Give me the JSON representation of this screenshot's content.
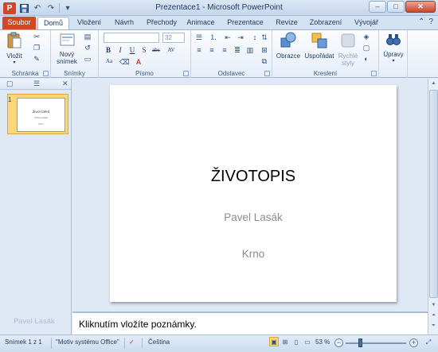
{
  "window": {
    "title": "Prezentace1 - Microsoft PowerPoint",
    "minimize_icon": "minimize-icon",
    "maximize_icon": "maximize-icon",
    "close_icon": "close-icon"
  },
  "qat": {
    "logo_text": "P",
    "save_icon": "save-icon",
    "undo_icon": "undo-icon",
    "redo_icon": "redo-icon"
  },
  "tabs": [
    {
      "label": "Soubor"
    },
    {
      "label": "Domů"
    },
    {
      "label": "Vložení"
    },
    {
      "label": "Návrh"
    },
    {
      "label": "Přechody"
    },
    {
      "label": "Animace"
    },
    {
      "label": "Prezentace"
    },
    {
      "label": "Revize"
    },
    {
      "label": "Zobrazení"
    },
    {
      "label": "Vývojář"
    }
  ],
  "ribbon": {
    "clipboard": {
      "paste_label": "Vložit",
      "group_label": "Schránka"
    },
    "slides": {
      "new_slide_label_1": "Nový",
      "new_slide_label_2": "snímek",
      "group_label": "Snímky"
    },
    "font": {
      "size_value": "32",
      "group_label": "Písmo",
      "bold": "B",
      "italic": "I",
      "underline": "U",
      "strike": "S",
      "shadow": "abc",
      "spacing": "AV",
      "case": "Aa"
    },
    "paragraph": {
      "group_label": "Odstavec"
    },
    "drawing": {
      "shapes_label": "Obrazce",
      "arrange_label": "Uspořádat",
      "quick_styles_label_1": "Rychlé",
      "quick_styles_label_2": "styly",
      "group_label": "Kreslení"
    },
    "editing": {
      "label": "Úpravy"
    }
  },
  "left_pane": {
    "slide_number": "1",
    "thumb_title": "ŽIVOTOPIS",
    "thumb_sub1": "Pavel Lasák",
    "thumb_sub2": "Krno",
    "watermark": "Pavel Lasák"
  },
  "slide": {
    "title": "ŽIVOTOPIS",
    "subtitle_1": "Pavel Lasák",
    "subtitle_2": "Krno"
  },
  "notes": {
    "placeholder": "Kliknutím vložíte poznámky."
  },
  "status": {
    "slide_indicator": "Snímek 1 z 1",
    "theme": "\"Motiv systému Office\"",
    "language": "Čeština",
    "zoom": "53 %",
    "zoom_fraction": 0.53
  }
}
